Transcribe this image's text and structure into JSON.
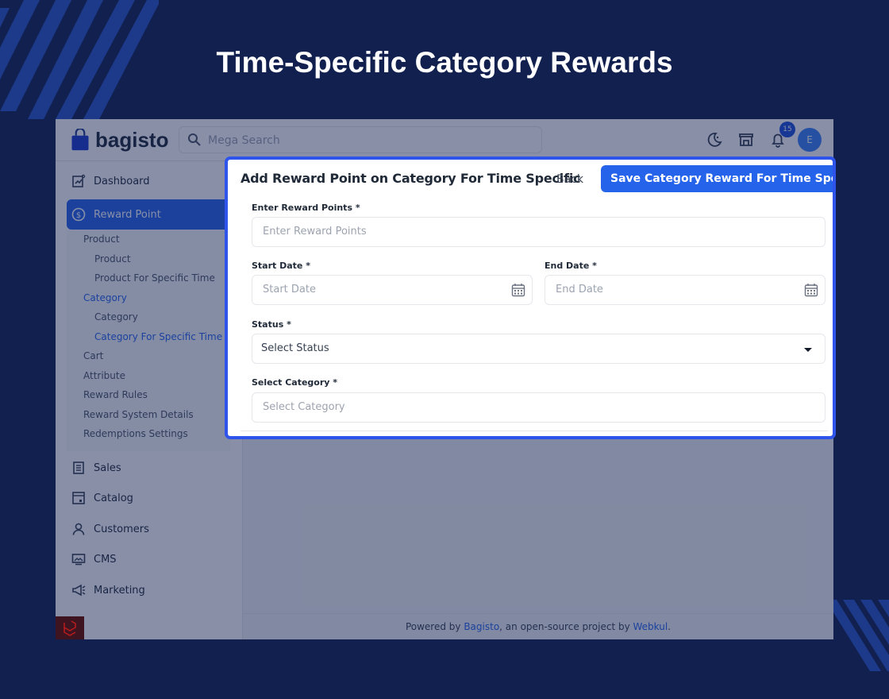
{
  "headline": "Time-Specific Category Rewards",
  "brand": "bagisto",
  "search": {
    "placeholder": "Mega Search"
  },
  "notifications": {
    "count": "15"
  },
  "user": {
    "initial": "E"
  },
  "sidebar": {
    "items": [
      {
        "label": "Dashboard",
        "icon": "dashboard-icon"
      },
      {
        "label": "Reward Point",
        "icon": "reward-icon",
        "active": true
      },
      {
        "label": "Sales",
        "icon": "sales-icon"
      },
      {
        "label": "Catalog",
        "icon": "catalog-icon"
      },
      {
        "label": "Customers",
        "icon": "customers-icon"
      },
      {
        "label": "CMS",
        "icon": "cms-icon"
      },
      {
        "label": "Marketing",
        "icon": "marketing-icon"
      }
    ],
    "submenu": [
      {
        "label": "Product",
        "level": 1
      },
      {
        "label": "Product",
        "level": 2
      },
      {
        "label": "Product For Specific Time",
        "level": 2
      },
      {
        "label": "Category",
        "level": 1,
        "active": true
      },
      {
        "label": "Category",
        "level": 2
      },
      {
        "label": "Category For Specific Time",
        "level": 2,
        "active": true
      },
      {
        "label": "Cart",
        "level": 1
      },
      {
        "label": "Attribute",
        "level": 1
      },
      {
        "label": "Reward Rules",
        "level": 1
      },
      {
        "label": "Reward System Details",
        "level": 1
      },
      {
        "label": "Redemptions Settings",
        "level": 1
      }
    ]
  },
  "form": {
    "title": "Add Reward Point on Category For Time Specific",
    "back_label": "Back",
    "save_label": "Save Category Reward For Time Specific",
    "reward_points": {
      "label": "Enter Reward Points *",
      "placeholder": "Enter Reward Points"
    },
    "start_date": {
      "label": "Start Date *",
      "placeholder": "Start Date"
    },
    "end_date": {
      "label": "End Date *",
      "placeholder": "End Date"
    },
    "status": {
      "label": "Status *",
      "value": "Select Status"
    },
    "category": {
      "label": "Select Category *",
      "placeholder": "Select Category"
    }
  },
  "footer": {
    "prefix": "Powered by ",
    "link1": "Bagisto",
    "middle": ", an open-source project by ",
    "link2": "Webkul",
    "suffix": "."
  },
  "colors": {
    "background": "#12204f",
    "accent": "#2563eb",
    "card_border": "#2f54eb"
  }
}
